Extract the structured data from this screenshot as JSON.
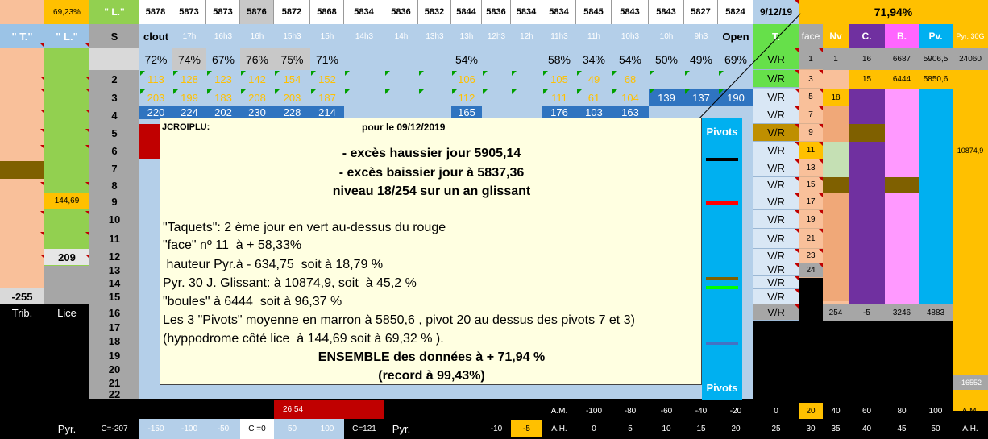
{
  "top_row": {
    "pct": "69,23%",
    "L": "\" L.\"",
    "values": [
      "5878",
      "5873",
      "5873",
      "5876",
      "5872",
      "5868",
      "5834",
      "5836",
      "5832",
      "5844",
      "5836",
      "5834",
      "5834",
      "5845",
      "5843",
      "5843",
      "5827",
      "5824"
    ],
    "date": "9/12/19",
    "total": "71,94%"
  },
  "left_headers": {
    "T": "\" T.\"",
    "L": "\" L.\"",
    "S": "S"
  },
  "time_headers": [
    "clout",
    "17h",
    "16h3",
    "16h",
    "15h3",
    "15h",
    "14h3",
    "14h",
    "13h3",
    "13h",
    "12h3",
    "12h",
    "11h3",
    "11h",
    "10h3",
    "10h",
    "9h3",
    "Open"
  ],
  "right_headers": {
    "T": "T.",
    "face": "face",
    "Nv": "Nv",
    "C": "C.",
    "B": "B.",
    "Pv": "Pv.",
    "Pyr": "Pyr. 30G"
  },
  "pct_row": [
    "72%",
    "74%",
    "67%",
    "76%",
    "75%",
    "71%",
    "",
    "",
    "",
    "54%",
    "",
    "",
    "58%",
    "34%",
    "54%",
    "50%",
    "49%",
    "69%"
  ],
  "row2": [
    "113",
    "128",
    "123",
    "142",
    "154",
    "152",
    "",
    "",
    "",
    "106",
    "",
    "",
    "105",
    "49",
    "68",
    "",
    "",
    ""
  ],
  "row3": [
    "203",
    "199",
    "183",
    "208",
    "203",
    "187",
    "",
    "",
    "",
    "112",
    "",
    "",
    "111",
    "61",
    "104",
    "139",
    "137",
    "190"
  ],
  "row4": [
    "220",
    "224",
    "202",
    "230",
    "228",
    "214",
    "",
    "",
    "",
    "165",
    "",
    "",
    "176",
    "103",
    "163",
    "",
    "",
    ""
  ],
  "s_numbers": [
    "2",
    "3",
    "4",
    "5",
    "6",
    "7",
    "8",
    "9",
    "10",
    "11",
    "12",
    "13",
    "14",
    "15",
    "16",
    "17",
    "18",
    "19",
    "20",
    "21",
    "22"
  ],
  "vr": "V/R",
  "face_numbers": [
    "1",
    "3",
    "5",
    "7",
    "9",
    "11",
    "13",
    "15",
    "17",
    "19",
    "21",
    "23",
    "24"
  ],
  "row1_right": {
    "Nv": "1",
    "C": "16",
    "B": "6687",
    "Pv": "5906,5",
    "Pyr": "24060"
  },
  "row2_right": {
    "C": "15",
    "B": "6444",
    "Pv": "5850,6"
  },
  "nv_18": "18",
  "pyr_mid": "10874,9",
  "pyr_bottom": "-16552",
  "bottom_right": {
    "Nv": "254",
    "C": "-5",
    "B": "3246",
    "Pv": "4883"
  },
  "left_col": {
    "v144": "144,69",
    "v209": "209",
    "v255": "-255",
    "trib": "Trib.",
    "lice": "Lice"
  },
  "popup": {
    "author": "JCROIPLU:",
    "date_line": "pour le 09/12/2019",
    "lines_bold": [
      "- excès haussier jour 5905,14",
      "- excès baissier jour à 5837,36",
      "niveau 18/254 sur un an glissant"
    ],
    "lines": [
      "\"Taquets\": 2 ème jour en vert au-dessus du rouge",
      "\"face\" nº 11  à + 58,33%",
      " hauteur Pyr.à - 634,75  soit à 18,79 %",
      "Pyr. 30 J. Glissant: à 10874,9, soit  à 45,2 %",
      "\"boules\" à 6444  soit à 96,37 %",
      "Les 3 \"Pivots\" moyenne en marron à 5850,6 , pivot 20 au dessus des pivots 7 et 3)",
      "(hyppodrome côté lice  à 144,69 soit à 69,32 % )."
    ],
    "summary": "ENSEMBLE des données à + 71,94 %",
    "record": "(record à 99,43%)"
  },
  "pivots_label": "Pivots",
  "bottom": {
    "red1": "26,54",
    "pyr_left": "Pyr.",
    "pyr_mid": "Pyr.",
    "scale_left": [
      "C=-207",
      "-150",
      "-100",
      "-50",
      "C =0",
      "50",
      "100",
      "C=121"
    ],
    "am": "A.M.",
    "ah": "A.H.",
    "am_vals": [
      "-100",
      "-80",
      "-60",
      "-40",
      "-20",
      "0",
      "20",
      "40",
      "60",
      "80",
      "100"
    ],
    "ah_pre": [
      "-10",
      "-5"
    ],
    "ah_vals": [
      "0",
      "5",
      "10",
      "15",
      "20",
      "25",
      "30",
      "35",
      "40",
      "45",
      "50"
    ],
    "am_end": "A.M.",
    "ah_end": "A.H."
  }
}
